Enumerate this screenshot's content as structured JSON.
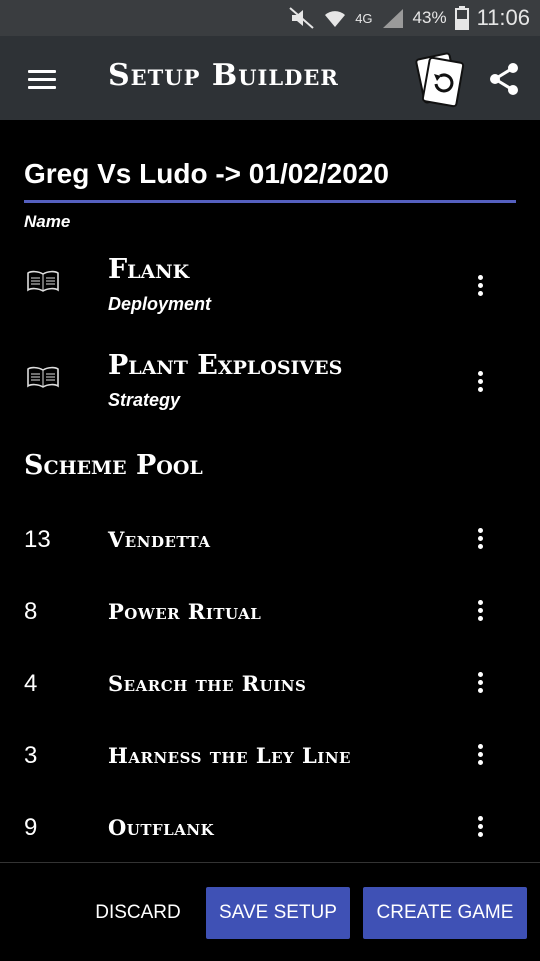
{
  "status_bar": {
    "battery": "43%",
    "network": "4G",
    "time": "11:06"
  },
  "app_bar": {
    "title": "Setup Builder"
  },
  "setup": {
    "name": "Greg Vs Ludo -> 01/02/2020",
    "name_label": "Name"
  },
  "cards": [
    {
      "title": "Flank",
      "subtitle": "Deployment"
    },
    {
      "title": "Plant Explosives",
      "subtitle": "Strategy"
    }
  ],
  "scheme_pool": {
    "heading": "Scheme Pool",
    "items": [
      {
        "number": "13",
        "name": "Vendetta"
      },
      {
        "number": "8",
        "name": "Power Ritual"
      },
      {
        "number": "4",
        "name": "Search the Ruins"
      },
      {
        "number": "3",
        "name": "Harness the Ley Line"
      },
      {
        "number": "9",
        "name": "Outflank"
      }
    ]
  },
  "actions": {
    "discard": "DISCARD",
    "save": "SAVE SETUP",
    "create": "CREATE GAME"
  },
  "colors": {
    "accent": "#3f51b5",
    "appbar": "#2e3236",
    "statusbar": "#3a3d40",
    "underline": "#5560c0"
  },
  "icons": [
    "menu-icon",
    "reset-card-icon",
    "share-icon",
    "book-icon",
    "more-vert-icon"
  ]
}
